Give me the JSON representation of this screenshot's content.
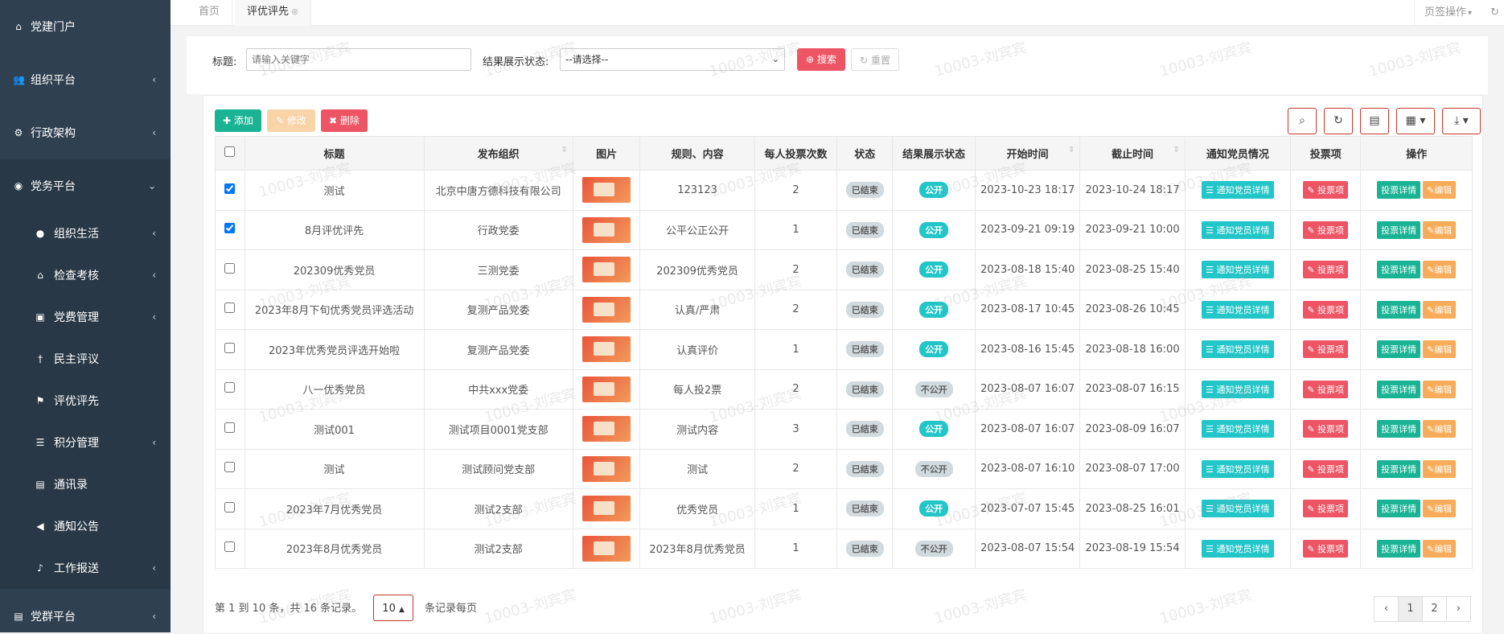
{
  "sidebar": {
    "items": [
      {
        "label": "党建门户",
        "icon": "home-icon",
        "glyph": "⌂",
        "arrow": ""
      },
      {
        "label": "组织平台",
        "icon": "users-icon",
        "glyph": "👥",
        "arrow": "‹"
      },
      {
        "label": "行政架构",
        "icon": "cogs-icon",
        "glyph": "⚙",
        "arrow": "‹"
      },
      {
        "label": "党务平台",
        "icon": "eye-icon",
        "glyph": "◉",
        "arrow": "⌄"
      }
    ],
    "subitems": [
      {
        "label": "组织生活",
        "icon": "comment-icon",
        "glyph": "●",
        "arrow": "‹"
      },
      {
        "label": "检查考核",
        "icon": "bank-icon",
        "glyph": "⌂",
        "arrow": "‹"
      },
      {
        "label": "党费管理",
        "icon": "money-icon",
        "glyph": "▣",
        "arrow": "‹"
      },
      {
        "label": "民主评议",
        "icon": "person-icon",
        "glyph": "†",
        "arrow": ""
      },
      {
        "label": "评优评先",
        "icon": "flag-icon",
        "glyph": "⚑",
        "arrow": ""
      },
      {
        "label": "积分管理",
        "icon": "database-icon",
        "glyph": "☰",
        "arrow": "‹"
      },
      {
        "label": "通讯录",
        "icon": "contact-card-icon",
        "glyph": "▤",
        "arrow": ""
      },
      {
        "label": "通知公告",
        "icon": "bullhorn-icon",
        "glyph": "◀",
        "arrow": ""
      },
      {
        "label": "工作报送",
        "icon": "bell-icon",
        "glyph": "♪",
        "arrow": "‹"
      }
    ],
    "bottom": {
      "label": "党群平台",
      "icon": "card-icon",
      "glyph": "▤",
      "arrow": "‹"
    }
  },
  "tabs": {
    "home": "首页",
    "current": "评优评先",
    "close": "⊗",
    "ops": "页签操作",
    "ops_caret": "▾",
    "refresh": "↻"
  },
  "search": {
    "title_label": "标题:",
    "title_placeholder": "请输入关键字",
    "status_label": "结果展示状态:",
    "status_value": "--请选择--",
    "search_btn": "搜索",
    "reset_btn": "重置"
  },
  "toolbar": {
    "add": "添加",
    "edit": "修改",
    "delete": "删除"
  },
  "table": {
    "headers": [
      "标题",
      "发布组织",
      "图片",
      "规则、内容",
      "每人投票次数",
      "状态",
      "结果展示状态",
      "开始时间",
      "截止时间",
      "通知党员情况",
      "投票项",
      "操作"
    ],
    "action_notify": "通知党员详情",
    "action_vote": "投票项",
    "action_detail": "投票详情",
    "action_edit": "编辑",
    "rows": [
      {
        "checked": true,
        "title": "测试",
        "org": "北京中唐方德科技有限公司",
        "rule": "123123",
        "votes": "2",
        "status": "已结束",
        "show": "公开",
        "start": "2023-10-23 18:17",
        "end": "2023-10-24 18:17"
      },
      {
        "checked": true,
        "title": "8月评优评先",
        "org": "行政党委",
        "rule": "公平公正公开",
        "votes": "1",
        "status": "已结束",
        "show": "公开",
        "start": "2023-09-21 09:19",
        "end": "2023-09-21 10:00"
      },
      {
        "checked": false,
        "title": "202309优秀党员",
        "org": "三测党委",
        "rule": "202309优秀党员",
        "votes": "2",
        "status": "已结束",
        "show": "公开",
        "start": "2023-08-18 15:40",
        "end": "2023-08-25 15:40"
      },
      {
        "checked": false,
        "title": "2023年8月下旬优秀党员评选活动",
        "org": "复测产品党委",
        "rule": "认真/严肃",
        "votes": "2",
        "status": "已结束",
        "show": "公开",
        "start": "2023-08-17 10:45",
        "end": "2023-08-26 10:45"
      },
      {
        "checked": false,
        "title": "2023年优秀党员评选开始啦",
        "org": "复测产品党委",
        "rule": "认真评价",
        "votes": "1",
        "status": "已结束",
        "show": "公开",
        "start": "2023-08-16 15:45",
        "end": "2023-08-18 16:00"
      },
      {
        "checked": false,
        "title": "八一优秀党员",
        "org": "中共xxx党委",
        "rule": "每人投2票",
        "votes": "2",
        "status": "已结束",
        "show": "不公开",
        "start": "2023-08-07 16:07",
        "end": "2023-08-07 16:15"
      },
      {
        "checked": false,
        "title": "测试001",
        "org": "测试项目0001党支部",
        "rule": "测试内容",
        "votes": "3",
        "status": "已结束",
        "show": "公开",
        "start": "2023-08-07 16:07",
        "end": "2023-08-09 16:07"
      },
      {
        "checked": false,
        "title": "测试",
        "org": "测试顾问党支部",
        "rule": "测试",
        "votes": "2",
        "status": "已结束",
        "show": "不公开",
        "start": "2023-08-07 16:10",
        "end": "2023-08-07 17:00"
      },
      {
        "checked": false,
        "title": "2023年7月优秀党员",
        "org": "测试2支部",
        "rule": "优秀党员",
        "votes": "1",
        "status": "已结束",
        "show": "公开",
        "start": "2023-07-07 15:45",
        "end": "2023-08-25 16:01"
      },
      {
        "checked": false,
        "title": "2023年8月优秀党员",
        "org": "测试2支部",
        "rule": "2023年8月优秀党员",
        "votes": "1",
        "status": "已结束",
        "show": "不公开",
        "start": "2023-08-07 15:54",
        "end": "2023-08-19 15:54"
      }
    ]
  },
  "pagination": {
    "summary": "第 1 到 10 条，共 16 条记录。",
    "page_size": "10",
    "per_page_suffix": "条记录每页",
    "prev": "‹",
    "next": "›",
    "pages": [
      "1",
      "2"
    ]
  },
  "watermark": "10003-刘宾宾",
  "colors": {
    "sidebar": "#2f4050",
    "danger": "#ed5565",
    "info": "#23c6c8",
    "primary": "#1ab394",
    "warning": "#f8ac59"
  }
}
